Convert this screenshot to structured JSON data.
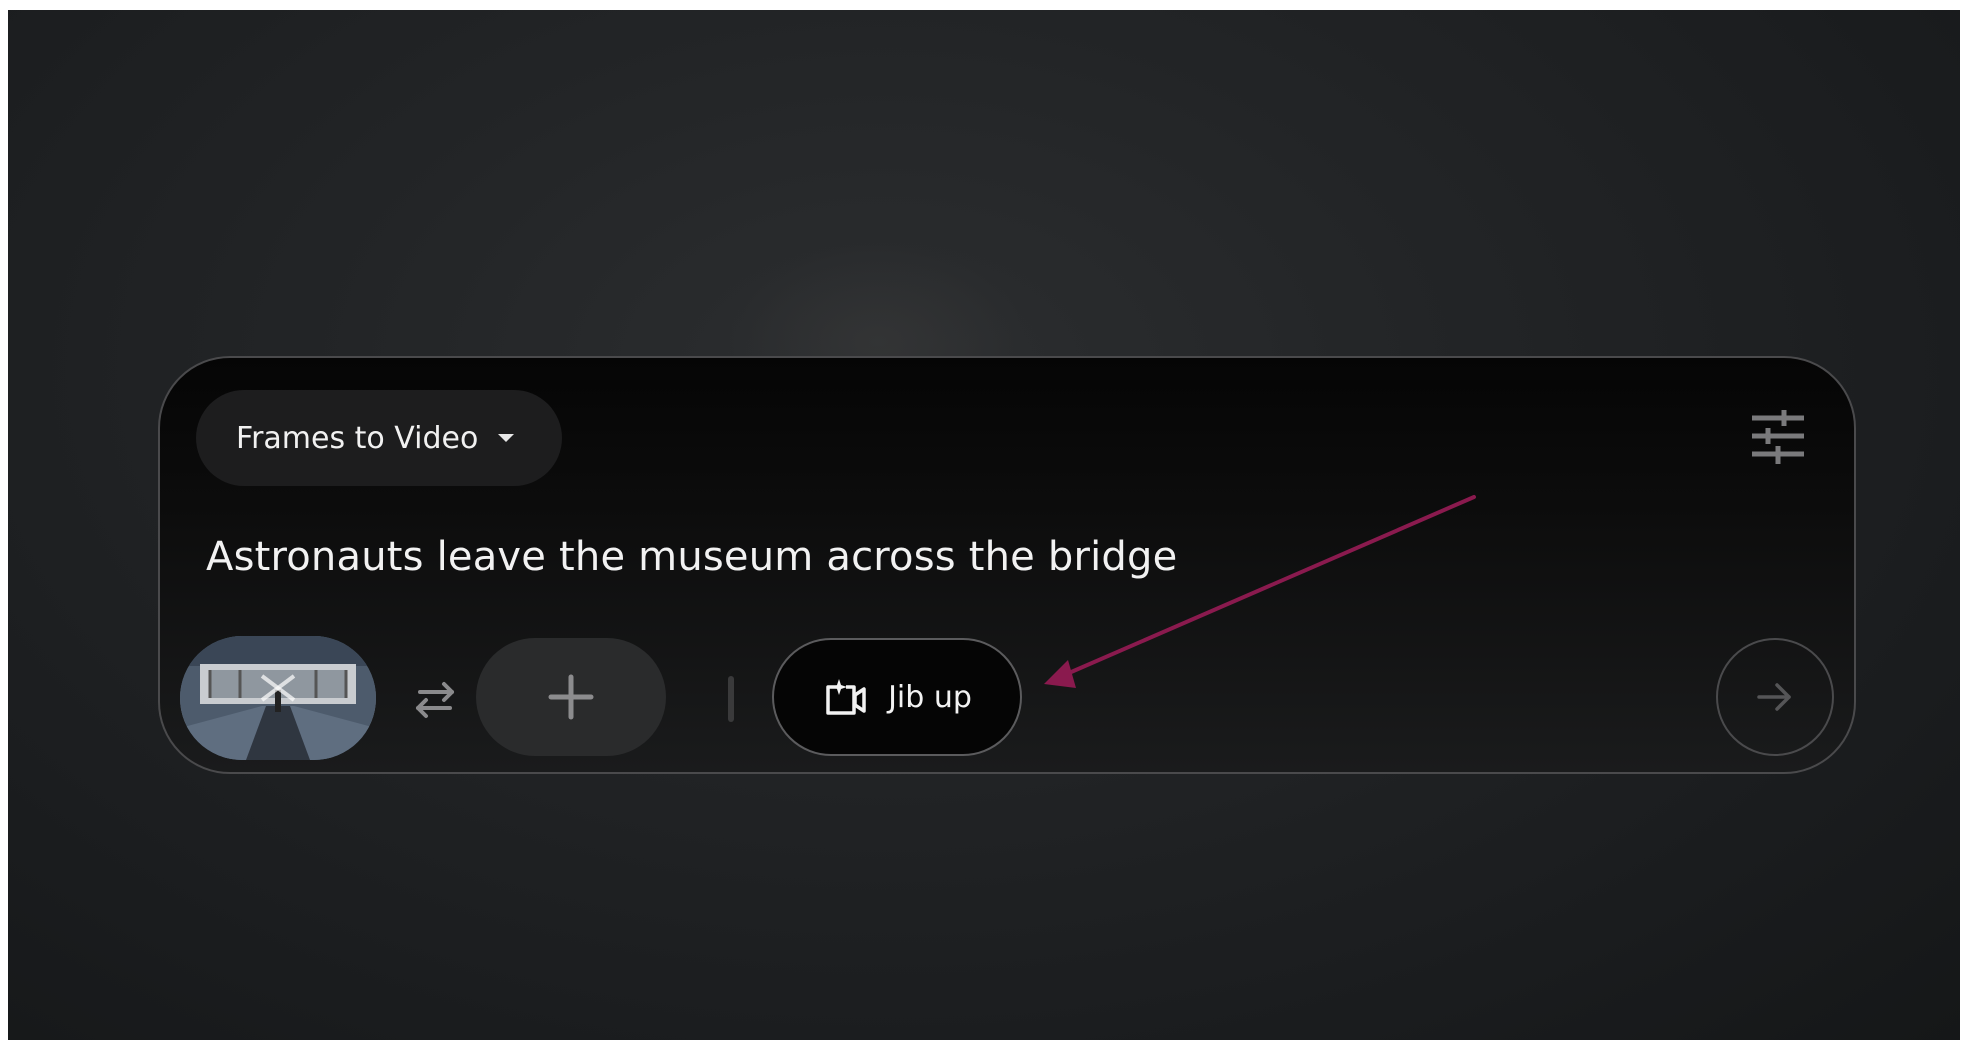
{
  "composer": {
    "mode_label": "Frames to Video",
    "prompt_text": "Astronauts leave the museum across the bridge",
    "camera_motion_label": "Jib up",
    "settings_icon": "tune-sliders-icon",
    "swap_icon": "swap-arrows-icon",
    "add_icon": "plus-icon",
    "camera_icon": "camera-sparkle-icon",
    "send_icon": "arrow-right-icon"
  },
  "colors": {
    "annotation_arrow": "#8a1a4e",
    "text_primary": "#f2f2f2",
    "panel_border": "#4a4a4c"
  }
}
